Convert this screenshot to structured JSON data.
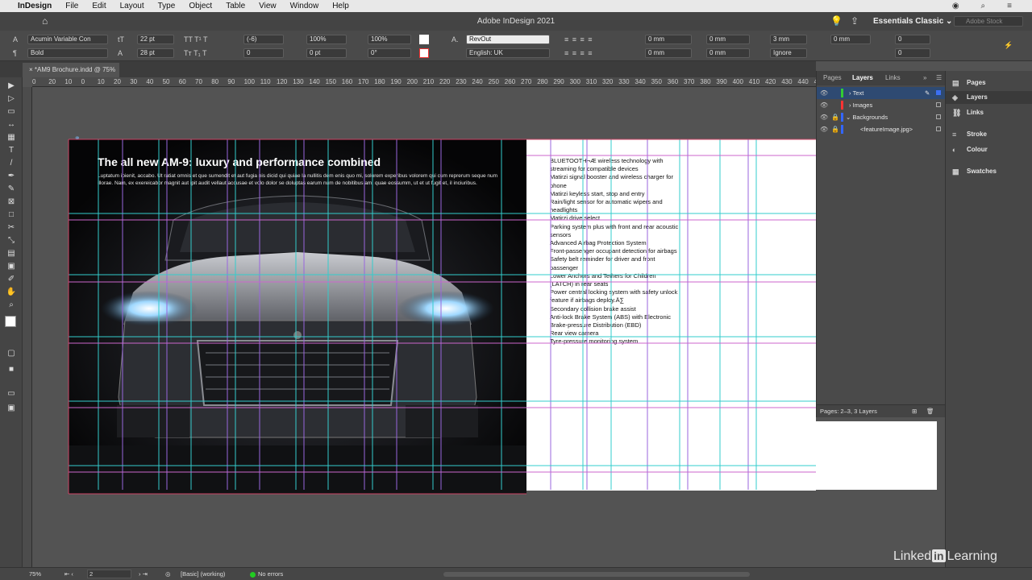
{
  "menubar": {
    "app_name": "InDesign",
    "items": [
      "File",
      "Edit",
      "Layout",
      "Type",
      "Object",
      "Table",
      "View",
      "Window",
      "Help"
    ]
  },
  "titlebar": {
    "title": "Adobe InDesign 2021",
    "workspace": "Essentials Classic",
    "search_placeholder": "Adobe Stock"
  },
  "control": {
    "font_family": "Acumin Variable Con",
    "font_style": "Bold",
    "font_size": "22 pt",
    "leading": "28 pt",
    "kerning": "(-6)",
    "tracking": "0",
    "vscale": "100%",
    "hscale": "100%",
    "baseline": "0 pt",
    "skew": "0°",
    "char_style": "RevOut",
    "language": "English: UK",
    "indent_left": "0 mm",
    "indent_right": "0 mm",
    "first_indent": "0 mm",
    "last_indent": "0 mm",
    "space_before": "3 mm",
    "space_after": "0 mm",
    "drop_cap_lines": "0",
    "drop_cap_chars": "0",
    "grid_align": "Ignore"
  },
  "document": {
    "tab_title": "*AM9 Brochure.indd @ 75%"
  },
  "ruler": {
    "marks": [
      "0",
      "20",
      "10",
      "0",
      "10",
      "20",
      "30",
      "40",
      "50",
      "60",
      "70",
      "80",
      "90",
      "100",
      "110",
      "120",
      "130",
      "140",
      "150",
      "160",
      "170",
      "180",
      "190",
      "200",
      "210",
      "220",
      "230",
      "240",
      "250",
      "260",
      "270",
      "280",
      "290",
      "300",
      "310",
      "320",
      "330",
      "340",
      "350",
      "360",
      "370",
      "380",
      "390",
      "400",
      "410",
      "420",
      "430",
      "440",
      "450"
    ]
  },
  "page_left": {
    "headline": "The all new AM-9: luxury and performance combined",
    "lede": "Luptatum ipienit, accabo. Ut ratiat omnis et que sumendit et aut fugia nis dicid qui quiae la nullitis dem enis quo mi, solorem experibus volorem qui cum reprerum seque num illorae. Nam, ex exereicabor magnit aut ipit audit vellaut accusae et volo dolor se doluptas earum num de nobitibus am, quae eossumm, ut et ut fugit et, il inciuribus."
  },
  "page_right": {
    "features": [
      "BLUETOOTH¬Æ wireless technology with streaming for compatible devices",
      "Matirzi signal booster and wireless charger for phone",
      "Matirzi keyless start, stop and entry",
      "Rain/light sensor for automatic wipers and headlights",
      "Matirzi drive select",
      "Parking system plus with front and rear acoustic sensors",
      "Advanced Airbag Protection System",
      "Front-passenger occupant detection for airbags",
      "Safety belt reminder for driver and front passenger",
      "Lower Anchors and Tethers for Children (LATCH) in rear seats",
      "Power central locking system with safety unlock feature if airbags deploy.Ä∑",
      "Secondary collision brake assist",
      "Anti-lock Brake System (ABS) with Electronic Brake-pressure Distribution (EBD)",
      "Rear view camera",
      "Tyre-pressure monitoring system"
    ]
  },
  "layers_panel": {
    "tabs": [
      "Pages",
      "Layers",
      "Links"
    ],
    "layers": [
      {
        "name": "Text",
        "color": "#33cc33"
      },
      {
        "name": "Images",
        "color": "#ff3333"
      },
      {
        "name": "Backgrounds",
        "color": "#3366ff"
      },
      {
        "name": "<featureImage.jpg>",
        "color": "#3366ff"
      }
    ],
    "footer": "Pages: 2–3, 3 Layers"
  },
  "side_panel": {
    "items": [
      "Pages",
      "Layers",
      "Links",
      "Stroke",
      "Colour",
      "Swatches"
    ]
  },
  "statusbar": {
    "zoom": "75%",
    "page": "2",
    "profile": "[Basic] (working)",
    "errors": "No errors"
  },
  "watermark": {
    "brand1": "Linked",
    "brand2": "in",
    "brand3": "Learning"
  }
}
